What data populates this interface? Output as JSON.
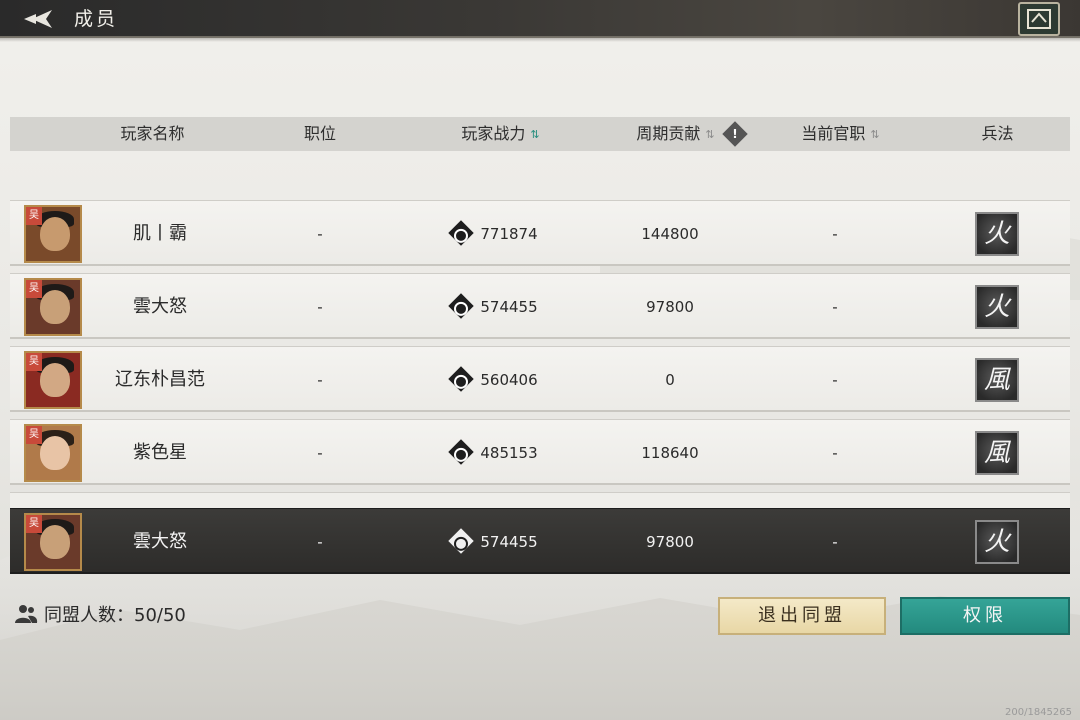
{
  "header": {
    "title": "成员",
    "back_icon": "back-arrow-icon",
    "corner_icon": "alliance-banner-icon"
  },
  "table": {
    "columns": {
      "name": "玩家名称",
      "position": "职位",
      "power": "玩家战力",
      "contribution": "周期贡献",
      "rank": "当前官职",
      "tactic": "兵法"
    },
    "rows": [
      {
        "name": "肌丨霸",
        "position": "-",
        "power": "771874",
        "contribution": "144800",
        "rank": "-",
        "tactic": "火",
        "faction": "吴"
      },
      {
        "name": "雲大怒",
        "position": "-",
        "power": "574455",
        "contribution": "97800",
        "rank": "-",
        "tactic": "火",
        "faction": "吴"
      },
      {
        "name": "辽东朴昌范",
        "position": "-",
        "power": "560406",
        "contribution": "0",
        "rank": "-",
        "tactic": "風",
        "faction": "吴"
      },
      {
        "name": "紫色星",
        "position": "-",
        "power": "485153",
        "contribution": "118640",
        "rank": "-",
        "tactic": "風",
        "faction": "吴"
      }
    ],
    "selected_row": {
      "name": "雲大怒",
      "position": "-",
      "power": "574455",
      "contribution": "97800",
      "rank": "-",
      "tactic": "火",
      "faction": "吴"
    }
  },
  "footer": {
    "members_label": "同盟人数：50/50",
    "leave_button": "退出同盟",
    "permission_button": "权限",
    "version": "200/1845265"
  },
  "colors": {
    "accent_teal": "#2a9a8c",
    "leave_button_bg": "#efe1b8",
    "selected_row_bg": "#333230"
  }
}
